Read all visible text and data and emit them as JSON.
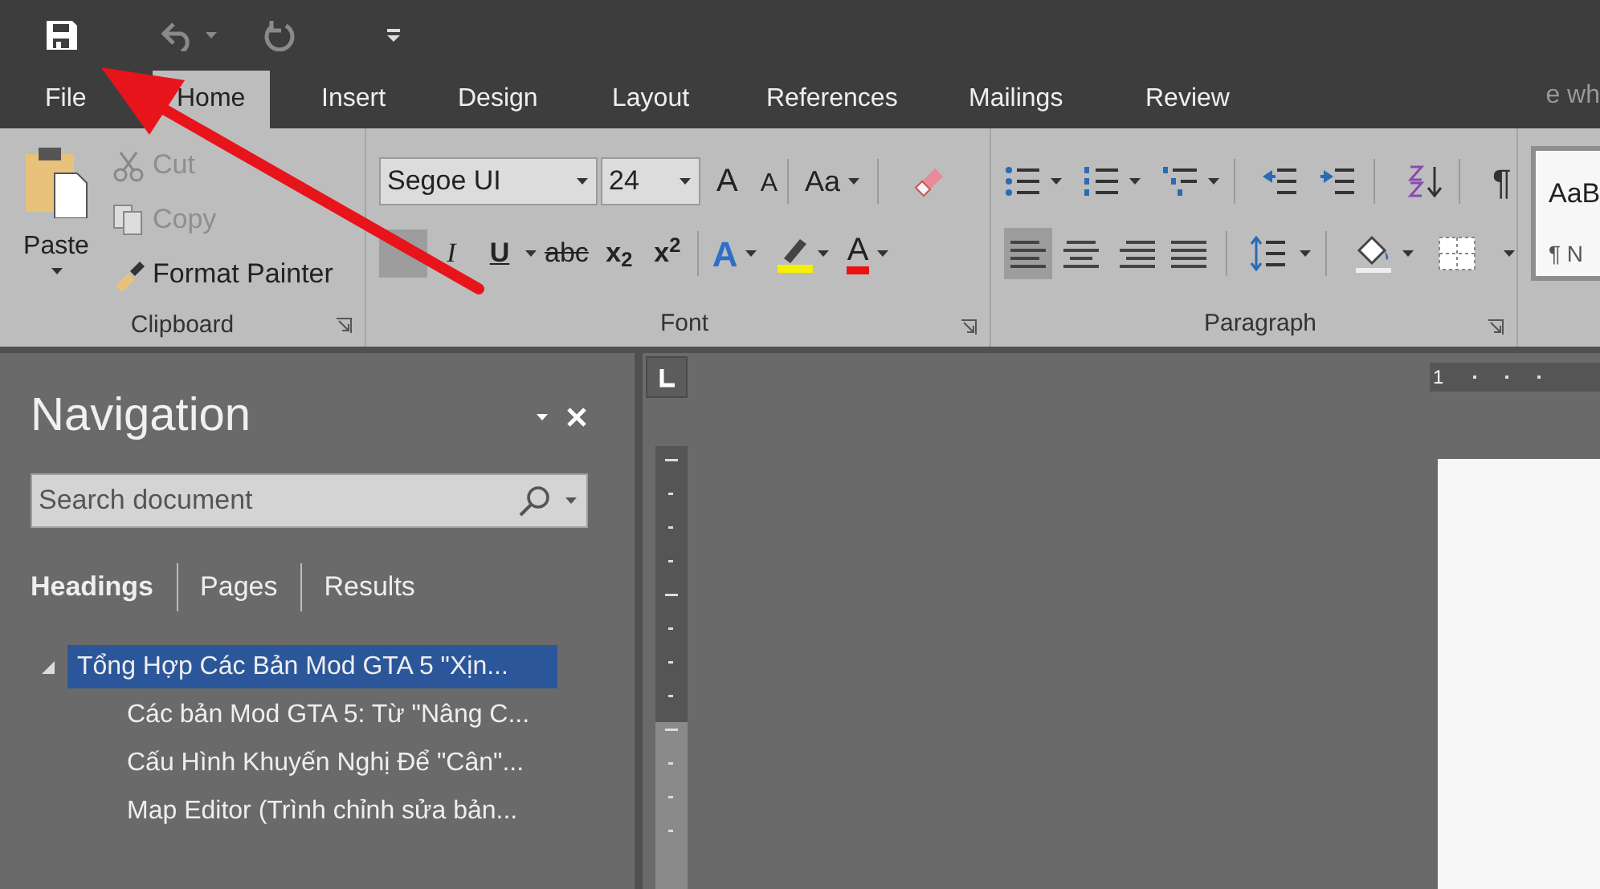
{
  "tabs": [
    {
      "label": "File",
      "selected": false
    },
    {
      "label": "Home",
      "selected": true
    },
    {
      "label": "Insert",
      "selected": false
    },
    {
      "label": "Design",
      "selected": false
    },
    {
      "label": "Layout",
      "selected": false
    },
    {
      "label": "References",
      "selected": false
    },
    {
      "label": "Mailings",
      "selected": false
    },
    {
      "label": "Review",
      "selected": false
    }
  ],
  "tell_me": "e wh",
  "clipboard": {
    "paste": "Paste",
    "label": "Clipboard",
    "buttons": [
      {
        "kind": "cut",
        "label": "Cut",
        "disabled": true
      },
      {
        "kind": "copy",
        "label": "Copy",
        "disabled": true
      },
      {
        "kind": "painter",
        "label": "Format Painter",
        "disabled": false
      }
    ]
  },
  "font": {
    "label": "Font",
    "font_name": "Segoe UI",
    "font_size": "24",
    "grow": "A",
    "shrink": "A",
    "change_case": "Aa",
    "format_buttons": [
      {
        "kind": "bold",
        "selected": true
      },
      {
        "kind": "italic",
        "label": "I",
        "selected": false
      },
      {
        "kind": "underline",
        "label": "U",
        "selected": false
      },
      {
        "kind": "strike",
        "label": "abc",
        "selected": false
      },
      {
        "kind": "sub",
        "label": "x$_{2}$",
        "selected": false
      },
      {
        "kind": "sup",
        "label": "x$^{2}$",
        "selected": false
      }
    ],
    "text_effects": "A",
    "font_color": "A"
  },
  "paragraph": {
    "label": "Paragraph",
    "alignments": [
      {
        "kind": "left",
        "selected": true
      },
      {
        "kind": "center",
        "selected": false
      },
      {
        "kind": "right",
        "selected": false
      },
      {
        "kind": "justify",
        "selected": false
      }
    ],
    "pilcrow": "¶"
  },
  "styles": {
    "sample": "AaB",
    "style_name": "¶ N"
  },
  "navigation": {
    "title": "Navigation",
    "search": {
      "placeholder": "Search document"
    },
    "tabs": [
      {
        "label": "Headings",
        "selected": true
      },
      {
        "label": "Pages",
        "selected": false
      },
      {
        "label": "Results",
        "selected": false
      }
    ],
    "headings": [
      {
        "text": "Tổng Hợp Các Bản Mod GTA 5 \"Xịn...",
        "selected": true,
        "expanded": true,
        "children": [
          {
            "text": "Các bản Mod GTA 5: Từ \"Nâng C...",
            "selected": false
          },
          {
            "text": "Cấu Hình Khuyến Nghị Để \"Cân\"...",
            "selected": false
          },
          {
            "text": "Map Editor (Trình chỉnh sửa bản...",
            "selected": false
          }
        ]
      }
    ]
  },
  "ruler": {
    "number": "1"
  }
}
